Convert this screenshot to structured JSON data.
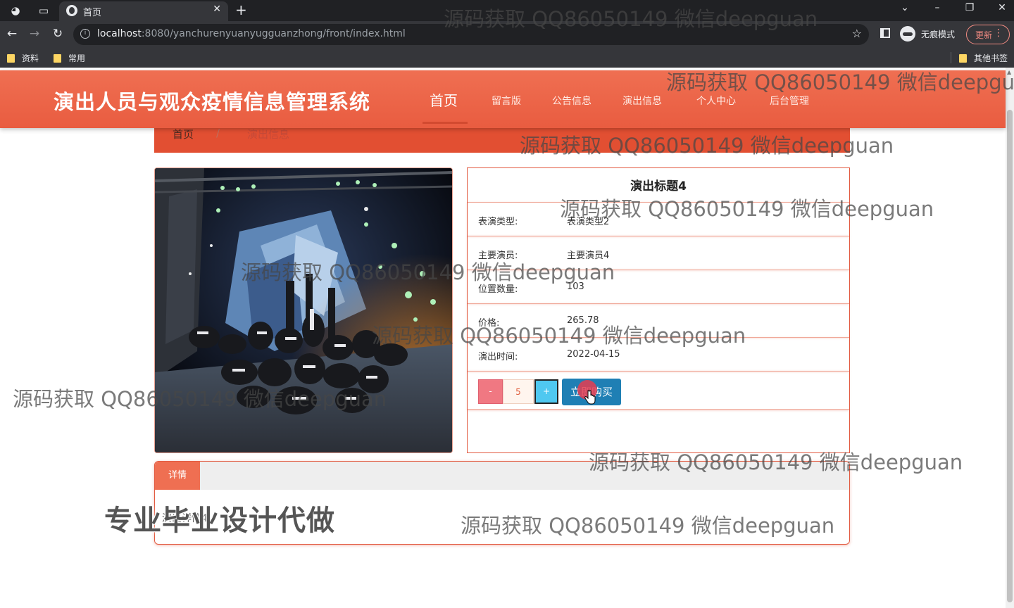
{
  "browser": {
    "tab_title": "首页",
    "url_host": "localhost",
    "url_rest": ":8080/yanchurenyuanyugguanzhong/front/index.html",
    "incognito_label": "无痕模式",
    "update_label": "更新",
    "bookmarks": [
      "资料",
      "常用"
    ],
    "other_bookmarks": "其他书签"
  },
  "site": {
    "title": "演出人员与观众疫情信息管理系统",
    "nav": [
      "首页",
      "留言版",
      "公告信息",
      "演出信息",
      "个人中心",
      "后台管理"
    ]
  },
  "breadcrumb": {
    "home": "首页",
    "separator": "/",
    "current": "演出信息"
  },
  "detail": {
    "title": "演出标题4",
    "fields": [
      {
        "label": "表演类型:",
        "value": "表演类型2"
      },
      {
        "label": "主要演员:",
        "value": "主要演员4"
      },
      {
        "label": "位置数量:",
        "value": "103"
      },
      {
        "label": "价格:",
        "value": "265.78"
      },
      {
        "label": "演出时间:",
        "value": "2022-04-15"
      }
    ],
    "quantity": "5",
    "minus_label": "-",
    "plus_label": "+",
    "buy_label": "立即购买"
  },
  "details_tab": {
    "label": "详情",
    "content": "演出详情4"
  },
  "watermark": {
    "text": "源码获取 QQ86050149 微信deepguan",
    "promo": "专业毕业设计代做"
  },
  "colors": {
    "header": "#e95c40",
    "accent": "#ef6f52",
    "buy_button": "#1f7fb4",
    "minus_button": "#f07882",
    "plus_button": "#4fc8f0"
  }
}
